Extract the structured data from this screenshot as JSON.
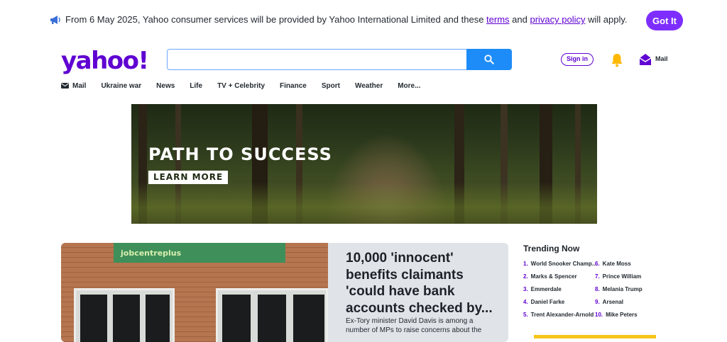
{
  "notice": {
    "prefix": "From 6 May 2025, Yahoo consumer services will be provided by Yahoo International Limited and these ",
    "terms": "terms",
    "and": " and ",
    "privacy": "privacy policy",
    "suffix": " will apply.",
    "button": "Got It"
  },
  "header": {
    "logo": "yahoo!",
    "search_value": "",
    "signin": "Sign in",
    "mail": "Mail"
  },
  "nav": [
    "Mail",
    "Ukraine war",
    "News",
    "Life",
    "TV + Celebrity",
    "Finance",
    "Sport",
    "Weather",
    "More..."
  ],
  "banner": {
    "headline": "PATH TO SUCCESS",
    "cta": "LEARN MORE"
  },
  "hero": {
    "sign_text": "jobcentreplus",
    "title": "10,000 'innocent' benefits claimants 'could have bank accounts checked by...",
    "description": "Ex-Tory minister David Davis is among a number of MPs to raise concerns about the"
  },
  "trending": {
    "title": "Trending Now",
    "left": [
      {
        "num": "1.",
        "label": "World Snooker Champ..."
      },
      {
        "num": "2.",
        "label": "Marks & Spencer"
      },
      {
        "num": "3.",
        "label": "Emmerdale"
      },
      {
        "num": "4.",
        "label": "Daniel Farke"
      },
      {
        "num": "5.",
        "label": "Trent Alexander-Arnold"
      }
    ],
    "right": [
      {
        "num": "6.",
        "label": "Kate Moss"
      },
      {
        "num": "7.",
        "label": "Prince William"
      },
      {
        "num": "8.",
        "label": "Melania Trump"
      },
      {
        "num": "9.",
        "label": "Arsenal"
      },
      {
        "num": "10.",
        "label": "Mike Peters"
      }
    ]
  },
  "colors": {
    "brand": "#6001d2",
    "button": "#7d2eff",
    "search_button": "#1d8cf8"
  }
}
